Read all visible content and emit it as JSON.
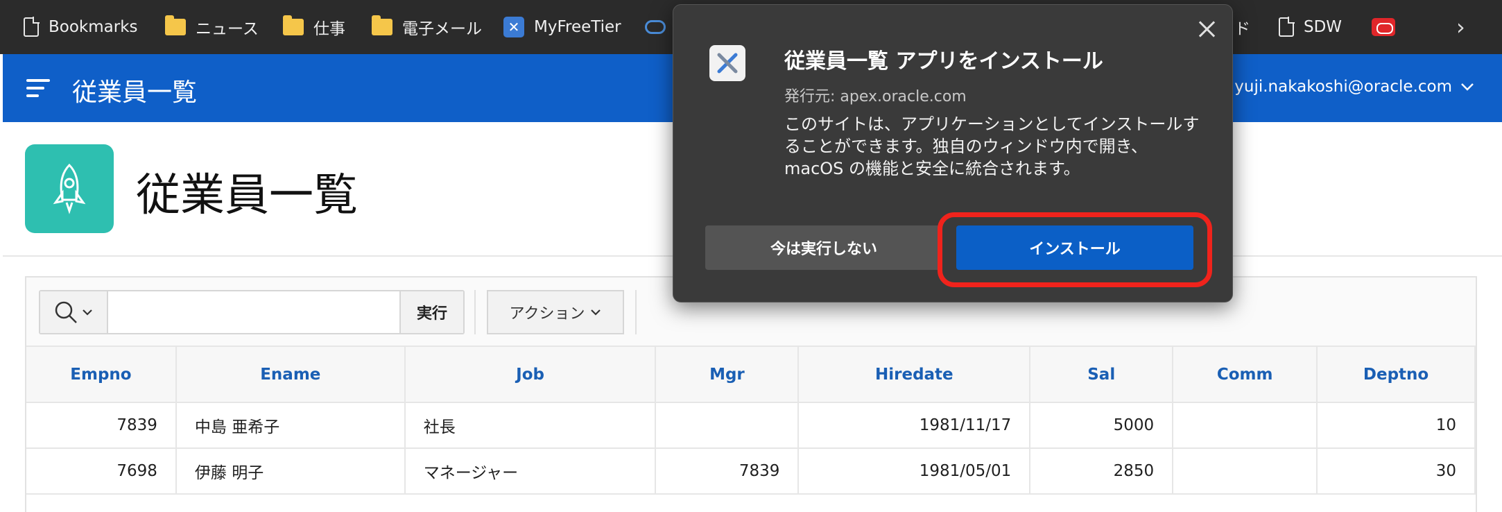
{
  "bookmarks": {
    "items": [
      {
        "label": "Bookmarks",
        "icon": "page-icon"
      },
      {
        "label": "ニュース",
        "icon": "folder-icon"
      },
      {
        "label": "仕事",
        "icon": "folder-icon"
      },
      {
        "label": "電子メール",
        "icon": "folder-icon"
      },
      {
        "label": "MyFreeTier",
        "icon": "tools-icon"
      },
      {
        "label": "ド",
        "icon": ""
      },
      {
        "label": "SDW",
        "icon": "page-icon"
      }
    ],
    "more_glyph": "›"
  },
  "header": {
    "app_title": "従業員一覧",
    "user": "yuji.nakakoshi@oracle.com"
  },
  "hero": {
    "title": "従業員一覧"
  },
  "toolbar": {
    "search_placeholder": "",
    "go_label": "実行",
    "actions_label": "アクション"
  },
  "report": {
    "columns": [
      "Empno",
      "Ename",
      "Job",
      "Mgr",
      "Hiredate",
      "Sal",
      "Comm",
      "Deptno"
    ],
    "rows": [
      {
        "empno": "7839",
        "ename": "中島 亜希子",
        "job": "社長",
        "mgr": "",
        "hiredate": "1981/11/17",
        "sal": "5000",
        "comm": "",
        "deptno": "10"
      },
      {
        "empno": "7698",
        "ename": "伊藤 明子",
        "job": "マネージャー",
        "mgr": "7839",
        "hiredate": "1981/05/01",
        "sal": "2850",
        "comm": "",
        "deptno": "30"
      }
    ]
  },
  "dialog": {
    "title": "従業員一覧 アプリをインストール",
    "publisher": "発行元: apex.oracle.com",
    "body": "このサイトは、アプリケーションとしてインストールすることができます。独自のウィンドウ内で開き、macOS の機能と安全に統合されます。",
    "cancel_label": "今は実行しない",
    "install_label": "インストール"
  },
  "colors": {
    "header_blue": "#0f5fc8",
    "install_blue": "#0b5fc6",
    "highlight_red": "#f0231c",
    "hero_icon_teal": "#2ebfb0"
  }
}
